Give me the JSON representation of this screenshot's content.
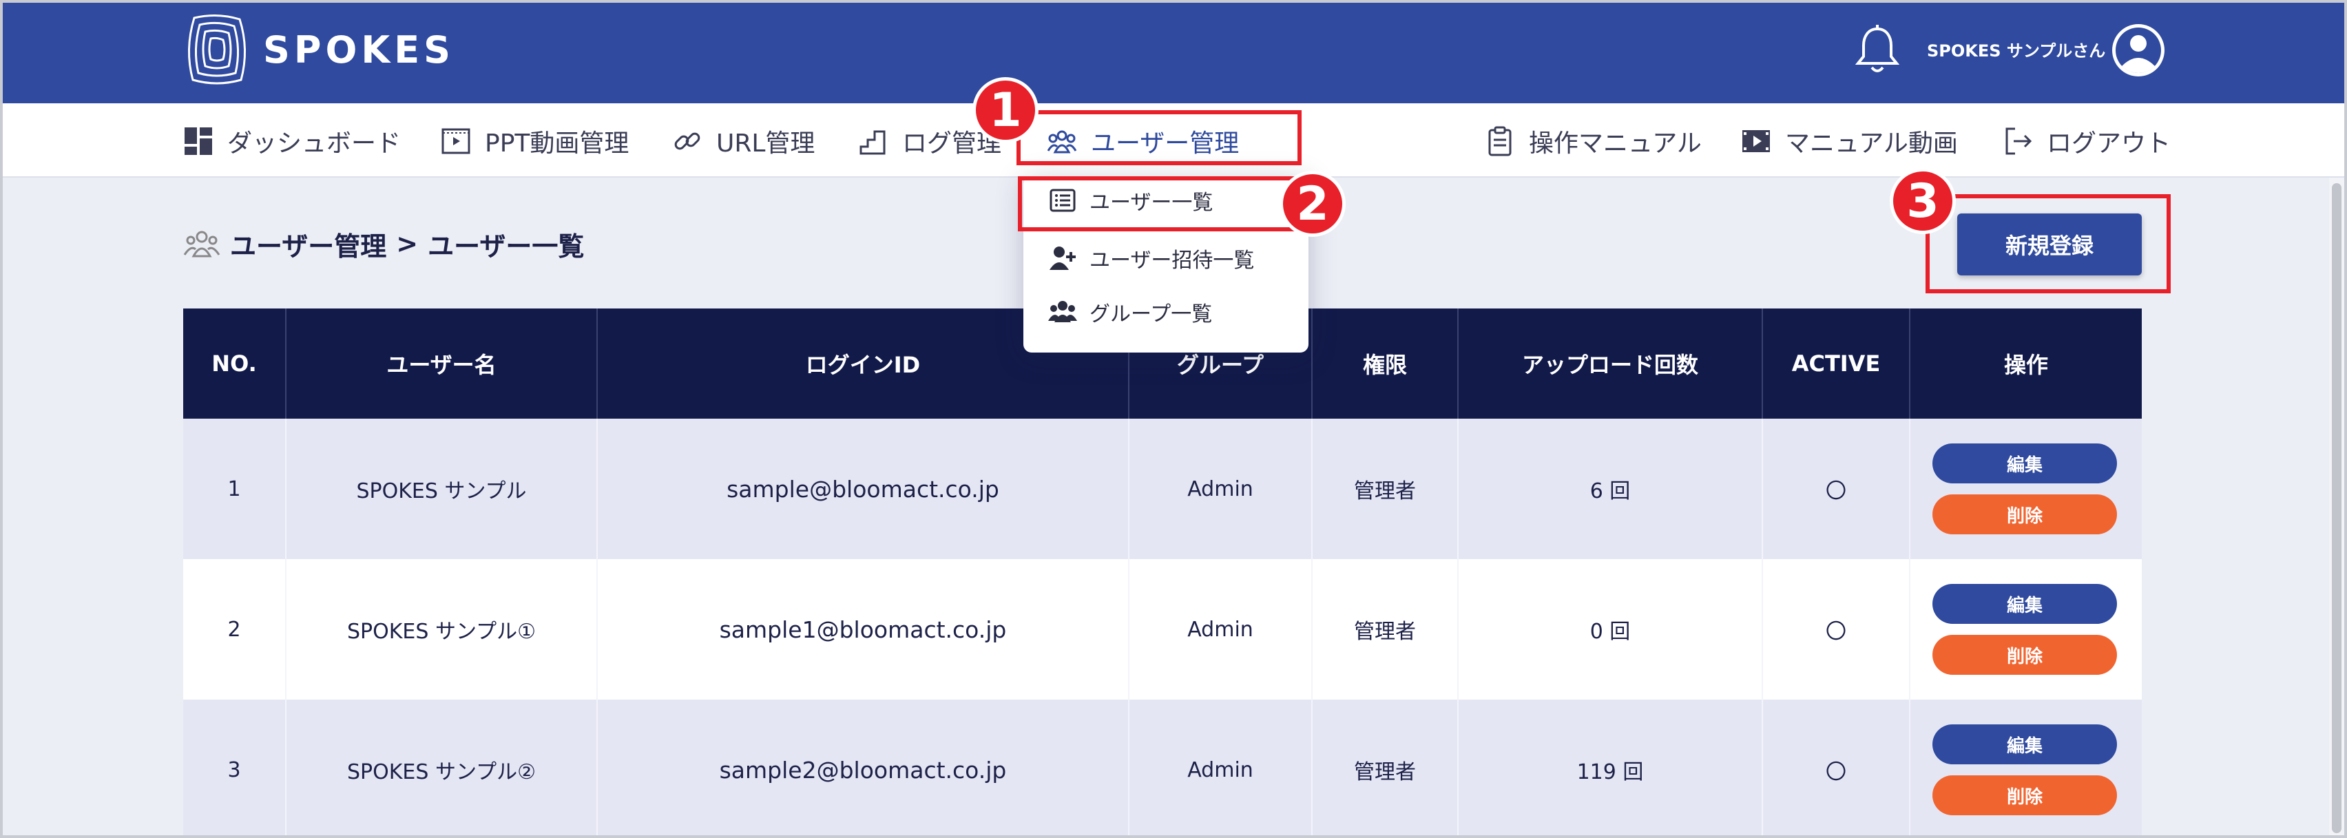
{
  "header": {
    "logo_text": "SPOKES",
    "user_name": "SPOKES サンプルさん"
  },
  "nav": {
    "items": [
      {
        "label": "ダッシュボード",
        "icon": "dashboard-icon"
      },
      {
        "label": "PPT動画管理",
        "icon": "ppt-video-icon"
      },
      {
        "label": "URL管理",
        "icon": "link-icon"
      },
      {
        "label": "ログ管理",
        "icon": "chart-step-icon"
      },
      {
        "label": "ユーザー管理",
        "icon": "users-icon"
      },
      {
        "label": "操作マニュアル",
        "icon": "manual-icon"
      },
      {
        "label": "マニュアル動画",
        "icon": "video-icon"
      },
      {
        "label": "ログアウト",
        "icon": "logout-icon"
      }
    ]
  },
  "dropdown": {
    "items": [
      {
        "label": "ユーザー一覧",
        "icon": "list-icon"
      },
      {
        "label": "ユーザー招待一覧",
        "icon": "user-plus-icon"
      },
      {
        "label": "グループ一覧",
        "icon": "group-icon"
      }
    ]
  },
  "annotations": {
    "badge1": "1",
    "badge2": "2",
    "badge3": "3"
  },
  "breadcrumb": {
    "parent": "ユーザー管理",
    "separator": ">",
    "current": "ユーザー一覧"
  },
  "actions": {
    "new_label": "新規登録",
    "edit_label": "編集",
    "delete_label": "削除"
  },
  "table": {
    "headers": [
      "NO.",
      "ユーザー名",
      "ログインID",
      "グループ",
      "権限",
      "アップロード回数",
      "ACTIVE",
      "操作"
    ],
    "rows": [
      {
        "no": "1",
        "name": "SPOKES サンプル",
        "login": "sample@bloomact.co.jp",
        "group": "Admin",
        "role": "管理者",
        "uploads": "6 回",
        "active": "〇"
      },
      {
        "no": "2",
        "name": "SPOKES サンプル①",
        "login": "sample1@bloomact.co.jp",
        "group": "Admin",
        "role": "管理者",
        "uploads": "0 回",
        "active": "〇"
      },
      {
        "no": "3",
        "name": "SPOKES サンプル②",
        "login": "sample2@bloomact.co.jp",
        "group": "Admin",
        "role": "管理者",
        "uploads": "119 回",
        "active": "〇"
      }
    ]
  },
  "colors": {
    "primary": "#2f4a9e",
    "table_header": "#121a4a",
    "delete": "#f06430",
    "annotation": "#e8202a"
  }
}
